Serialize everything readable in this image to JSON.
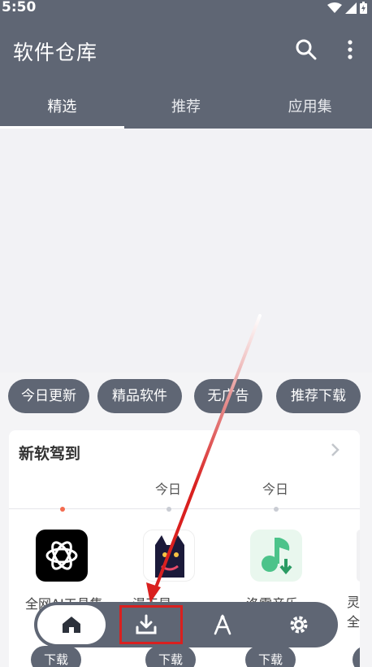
{
  "status_bar": {
    "time": "5:50"
  },
  "app_bar": {
    "title": "软件仓库"
  },
  "tabs": [
    {
      "label": "精选",
      "active": true
    },
    {
      "label": "推荐",
      "active": false
    },
    {
      "label": "应用集",
      "active": false
    }
  ],
  "chips": [
    "今日更新",
    "精品软件",
    "无广告",
    "推荐下载"
  ],
  "section": {
    "title": "新软驾到",
    "day_labels": [
      "今日",
      "今日"
    ],
    "apps": [
      {
        "name": "全网AI工具集",
        "icon": "openai-logo-icon",
        "download_label": "下载"
      },
      {
        "name": "漫天星",
        "icon": "cat-mascot-icon",
        "download_label": "下载"
      },
      {
        "name": "洛雪音乐",
        "icon": "music-download-icon",
        "download_label": "下载"
      },
      {
        "name": "灵全",
        "icon": "partial-app-icon",
        "download_label": ""
      }
    ]
  },
  "bottom_nav": [
    {
      "id": "home",
      "icon": "home-icon",
      "active": true
    },
    {
      "id": "downloads",
      "icon": "download-icon",
      "active": false
    },
    {
      "id": "apps",
      "icon": "compass-icon",
      "active": false
    },
    {
      "id": "settings",
      "icon": "gear-icon",
      "active": false
    }
  ],
  "annotation": {
    "color": "#d9201f",
    "target": "downloads"
  },
  "colors": {
    "primary": "#5f6674",
    "accent_dot": "#f36b4f",
    "background": "#f4f4f6"
  }
}
